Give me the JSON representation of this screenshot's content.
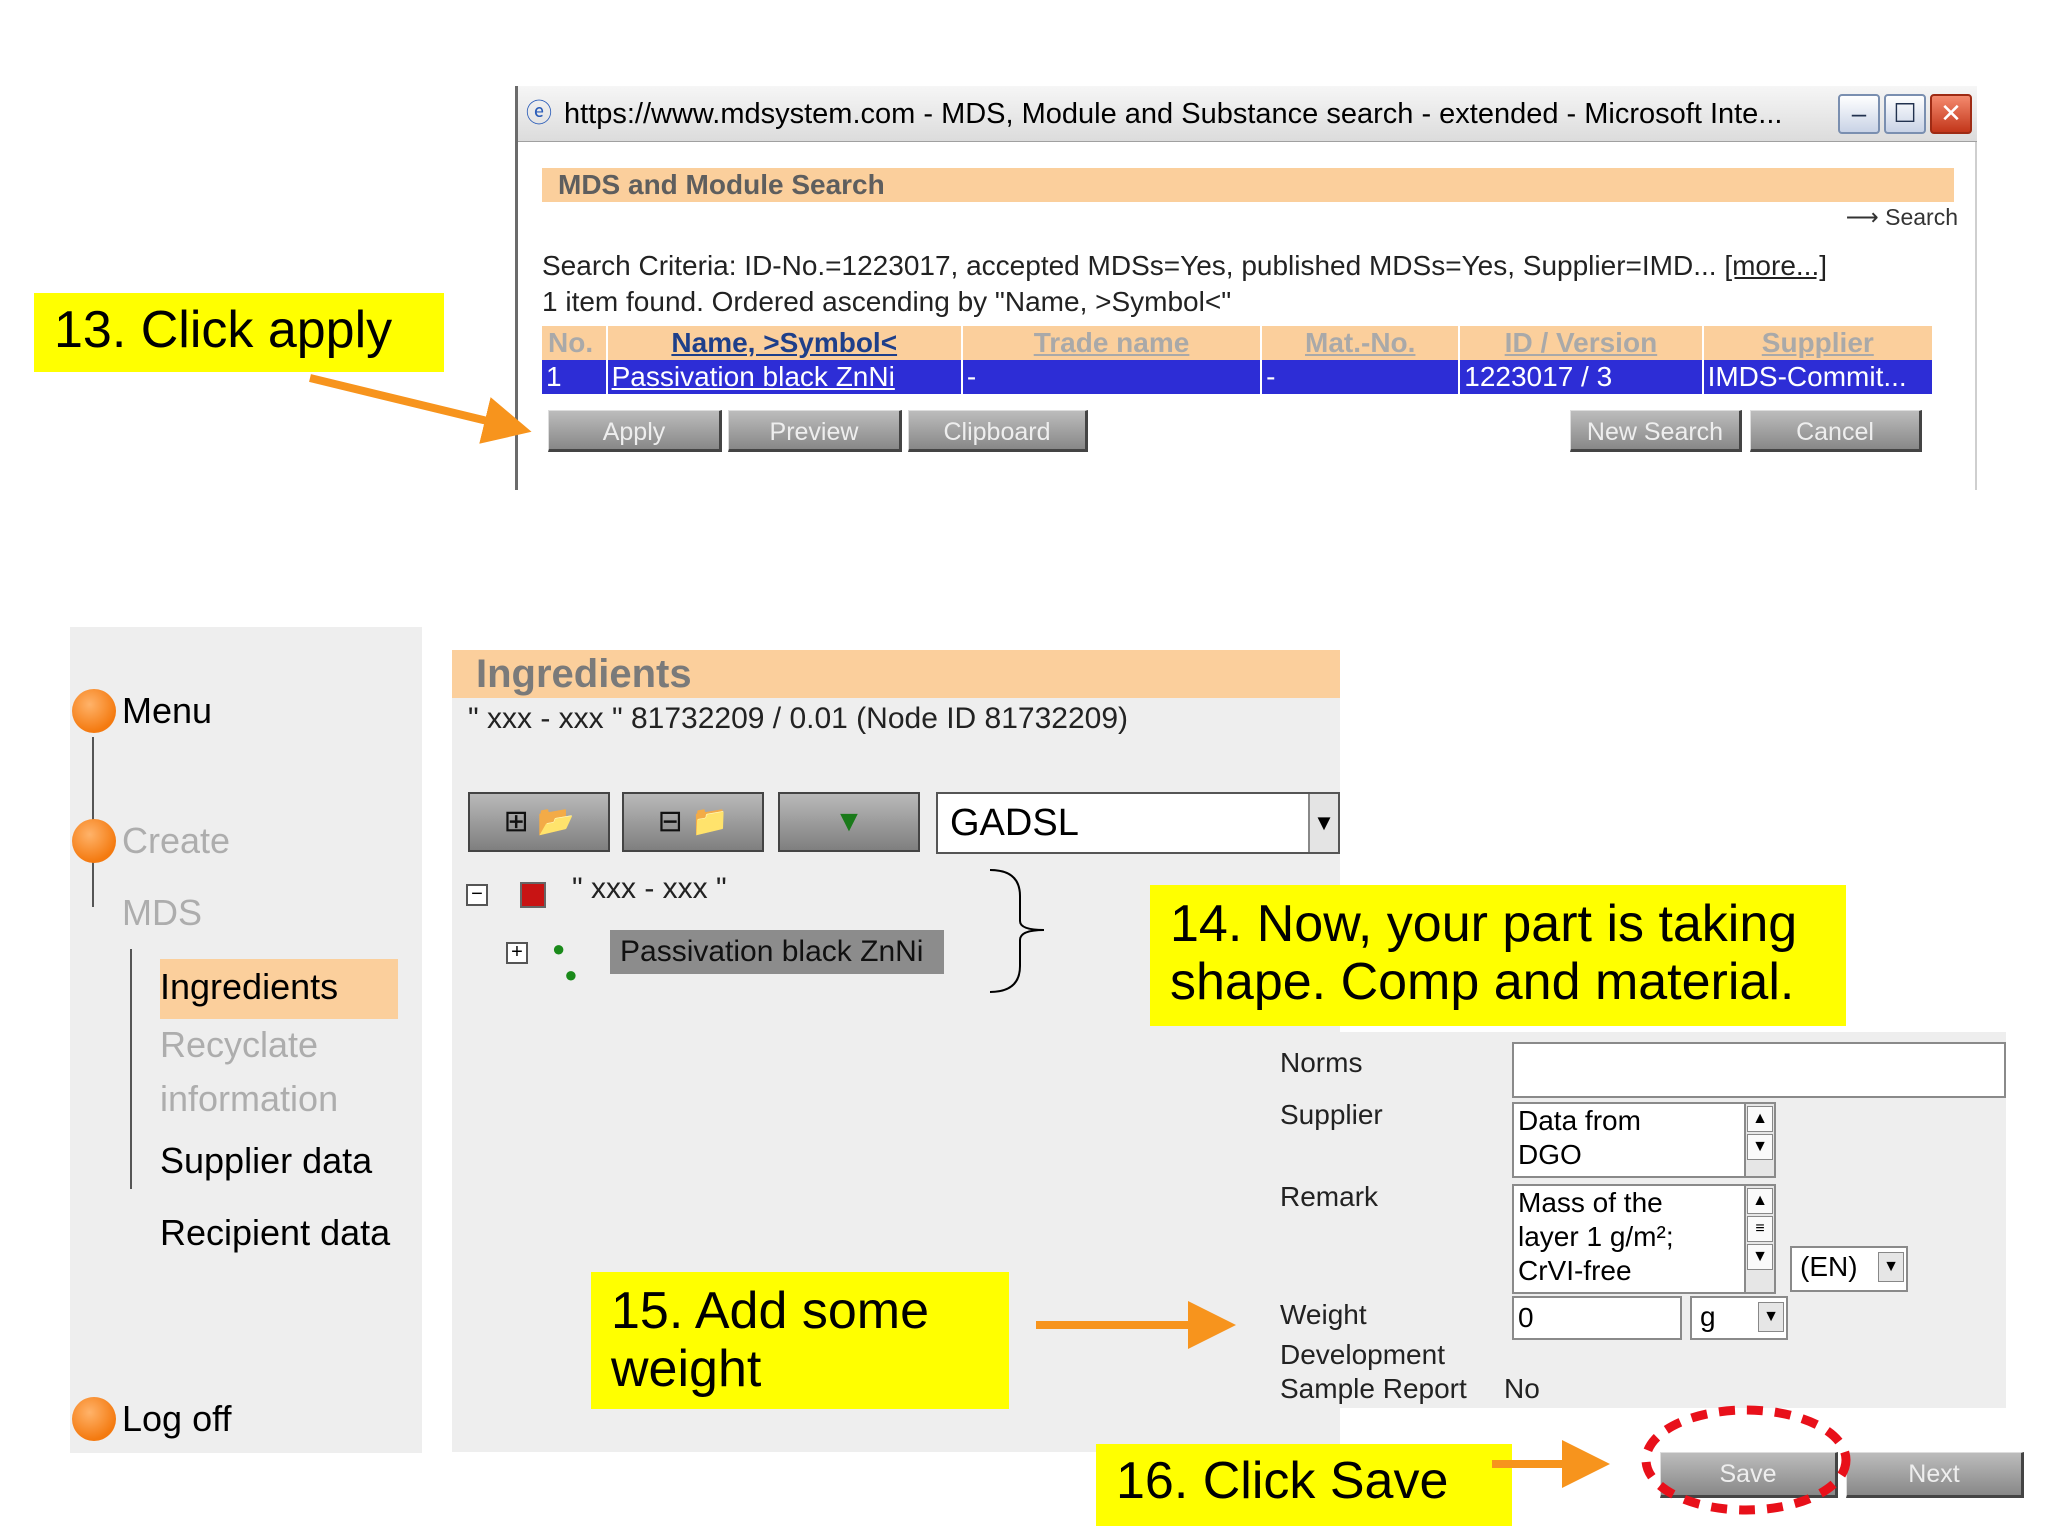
{
  "popup": {
    "window_title": "https://www.mdsystem.com - MDS, Module and Substance search - extended - Microsoft Inte...",
    "header": "MDS and Module Search",
    "search_link": "Search",
    "criteria": "Search Criteria: ID-No.=1223017, accepted MDSs=Yes, published MDSs=Yes, Supplier=IMD...",
    "more_link": "[more...]",
    "found": "1 item found. Ordered ascending by \"Name, >Symbol<\"",
    "columns": [
      "No.",
      "Name, >Symbol<",
      "Trade name",
      "Mat.-No.",
      "ID / Version",
      "Supplier"
    ],
    "row": {
      "no": "1",
      "name": "Passivation black ZnNi",
      "trade_name": "-",
      "mat_no": "-",
      "id_version": "1223017 / 3",
      "supplier": "IMDS-Commit..."
    },
    "buttons": {
      "apply": "Apply",
      "preview": "Preview",
      "clipboard": "Clipboard",
      "new_search": "New Search",
      "cancel": "Cancel"
    }
  },
  "callouts": {
    "c13": "13. Click apply",
    "c14": "14. Now, your part is taking shape. Comp and material.",
    "c15": "15. Add some weight",
    "c16": "16. Click Save"
  },
  "nav": {
    "menu": "Menu",
    "create": "Create",
    "mds": "MDS",
    "ingredients": "Ingredients",
    "recyclate_1": "Recyclate",
    "recyclate_2": "information",
    "supplier_data": "Supplier data",
    "recipient_data": "Recipient data",
    "log_off": "Log off"
  },
  "ingredients": {
    "title": "Ingredients",
    "subtitle": "\" xxx - xxx \" 81732209 / 0.01 (Node ID 81732209)",
    "filter_value": "GADSL",
    "tree_root": "\" xxx - xxx \"",
    "tree_child": "Passivation black ZnNi"
  },
  "form": {
    "norms_label": "Norms",
    "supplier_label": "Supplier",
    "supplier_value_1": "Data from",
    "supplier_value_2": "DGO",
    "remark_label": "Remark",
    "remark_value_1": "Mass of the",
    "remark_value_2": "layer 1 g/m²;",
    "remark_value_3": "CrVI-free",
    "language": "(EN)",
    "weight_label": "Weight",
    "weight_value": "0",
    "weight_unit": "g",
    "dev_label_1": "Development",
    "dev_label_2": "Sample Report",
    "dev_value": "No"
  },
  "footer_buttons": {
    "save": "Save",
    "next": "Next"
  },
  "colors": {
    "accent_orange": "#fbcf9c",
    "callout_yellow": "#ffff00",
    "arrow_orange": "#f7941d",
    "selection_blue": "#2d2dd6",
    "highlight_red": "#e8101a"
  }
}
